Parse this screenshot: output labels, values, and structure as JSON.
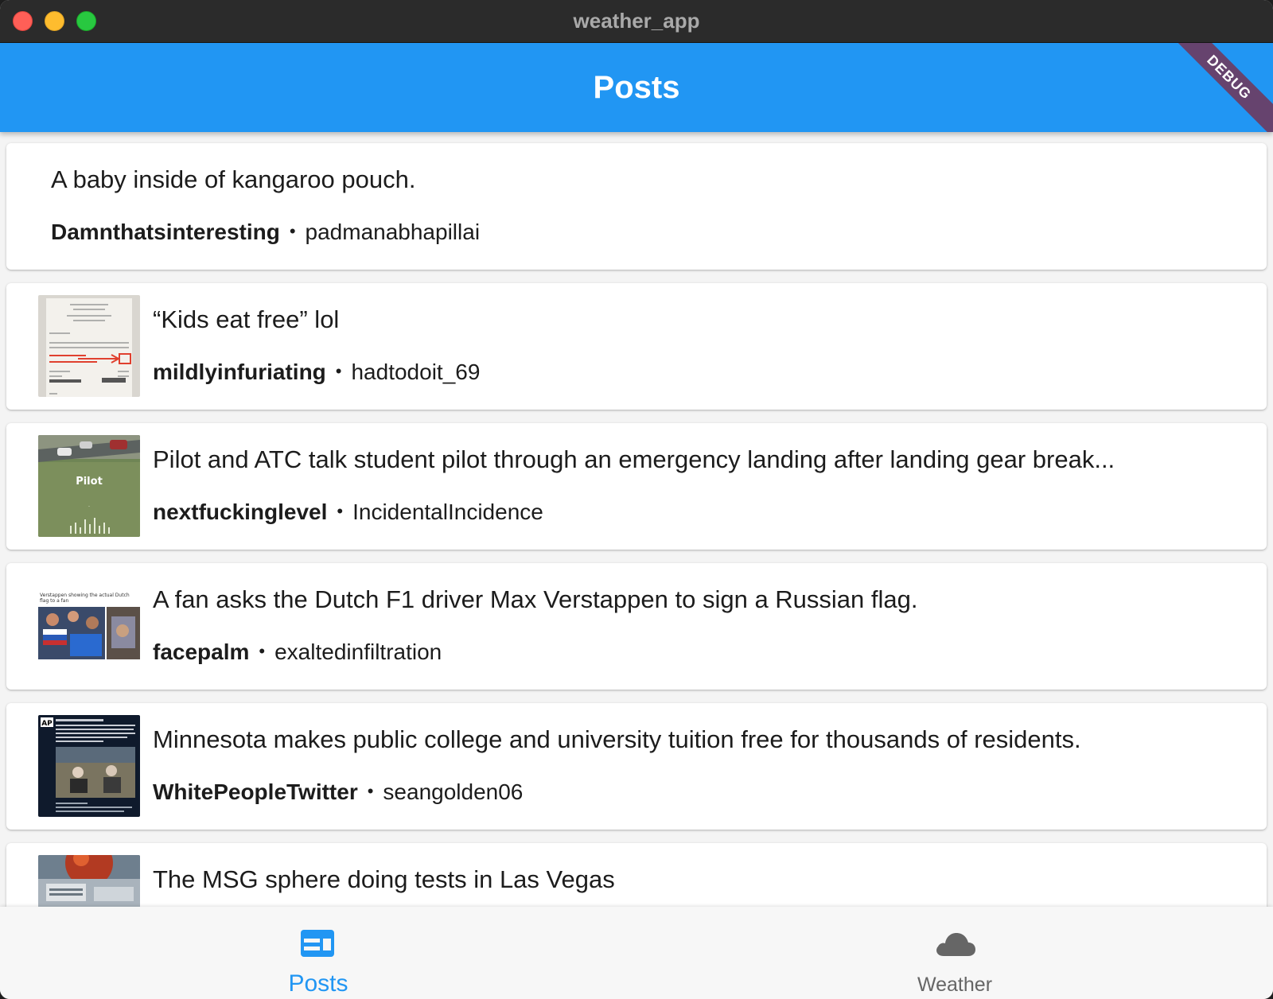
{
  "window": {
    "title": "weather_app"
  },
  "appbar": {
    "title": "Posts",
    "debug_banner": "DEBUG",
    "color": "#2196f3"
  },
  "posts": [
    {
      "title": "A baby inside of kangaroo pouch.",
      "subreddit": "Damnthatsinteresting",
      "author": "padmanabhapillai",
      "thumbnail": "none"
    },
    {
      "title": "“Kids eat free” lol",
      "subreddit": "mildlyinfuriating",
      "author": "hadtodoit_69",
      "thumbnail": "receipt-photo"
    },
    {
      "title": "Pilot and ATC talk student pilot through an emergency landing after landing gear break...",
      "subreddit": "nextfuckinglevel",
      "author": "IncidentalIncidence",
      "thumbnail": "video-still",
      "thumb_text": "Pilot"
    },
    {
      "title": "A fan asks the Dutch F1 driver Max Verstappen to sign a Russian flag.",
      "subreddit": "facepalm",
      "author": "exaltedinfiltration",
      "thumbnail": "photo-collage",
      "thumb_text": "Verstappen showing the actual Dutch flag to a fan"
    },
    {
      "title": "Minnesota makes public college and university tuition free for thousands of residents.",
      "subreddit": "WhitePeopleTwitter",
      "author": "seangolden06",
      "thumbnail": "tweet-screenshot",
      "thumb_text": "AP"
    },
    {
      "title": "The MSG sphere doing tests in Las Vegas",
      "subreddit": "",
      "author": "",
      "thumbnail": "city-photo"
    }
  ],
  "meta_separator": "•",
  "bottom_nav": {
    "items": [
      {
        "label": "Posts",
        "icon": "article-icon",
        "active": true,
        "color": "#2196f3"
      },
      {
        "label": "Weather",
        "icon": "cloud-icon",
        "active": false,
        "color": "#666666"
      }
    ]
  }
}
